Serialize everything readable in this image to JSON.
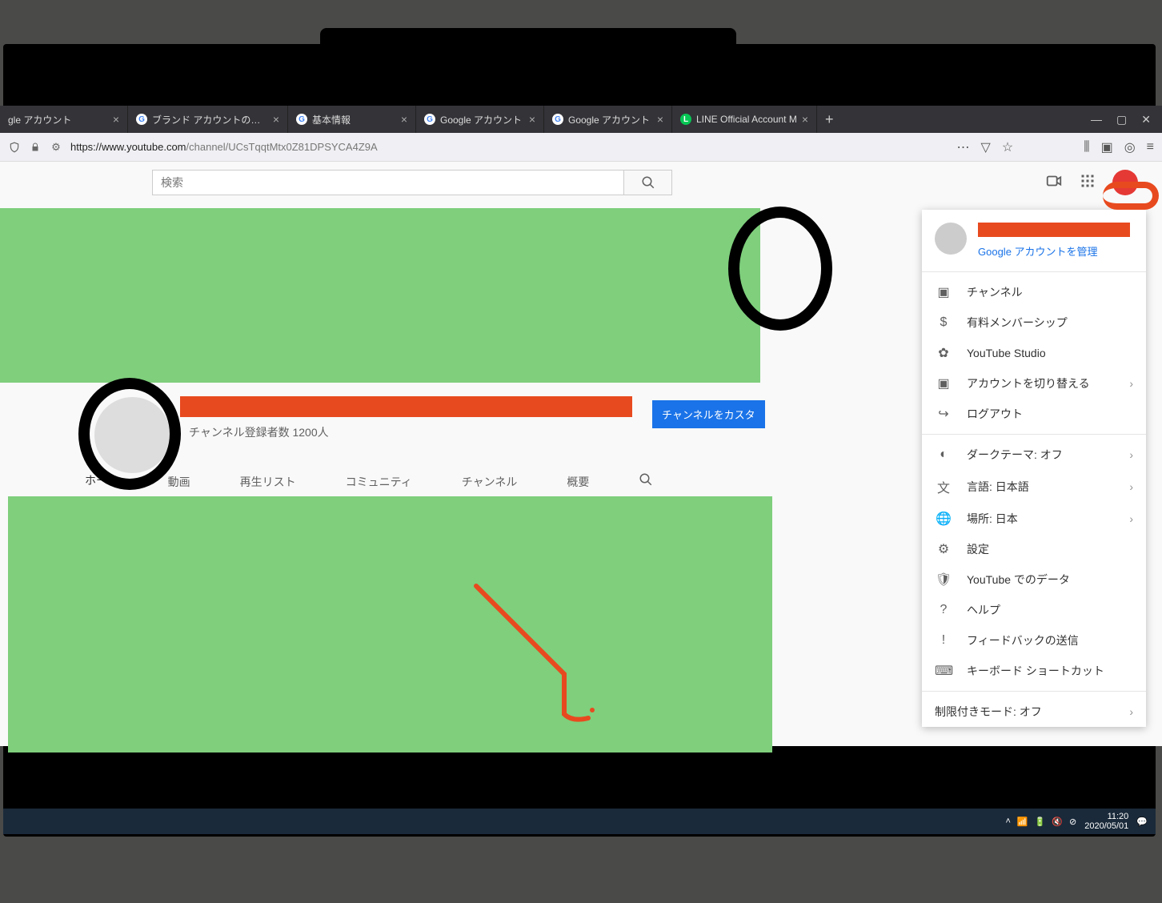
{
  "tabs": [
    {
      "label": "gle アカウント",
      "favicon": "G"
    },
    {
      "label": "ブランド アカウントの詳細",
      "favicon": "G"
    },
    {
      "label": "基本情報",
      "favicon": "G"
    },
    {
      "label": "Google アカウント",
      "favicon": "G"
    },
    {
      "label": "Google アカウント",
      "favicon": "G"
    },
    {
      "label": "LINE Official Account M",
      "favicon": "L"
    }
  ],
  "url": {
    "scheme_host": "https://www.youtube.com",
    "path": "/channel/UCsTqqtMtx0Z81DPSYCA4Z9A"
  },
  "search": {
    "placeholder": "検索"
  },
  "channel": {
    "subscribers": "チャンネル登録者数 1200人",
    "customize": "チャンネルをカスタ",
    "tabs": [
      "ホーム",
      "動画",
      "再生リスト",
      "コミュニティ",
      "チャンネル",
      "概要"
    ]
  },
  "account_menu": {
    "manage": "Google アカウントを管理",
    "section1": [
      {
        "icon": "👤",
        "label": "チャンネル"
      },
      {
        "icon": "💲",
        "label": "有料メンバーシップ"
      },
      {
        "icon": "⚙",
        "label": "YouTube Studio"
      },
      {
        "icon": "🔀",
        "label": "アカウントを切り替える",
        "arrow": true
      },
      {
        "icon": "↪",
        "label": "ログアウト"
      }
    ],
    "section2": [
      {
        "icon": "◐",
        "label": "ダークテーマ: オフ",
        "arrow": true
      },
      {
        "icon": "文",
        "label": "言語: 日本語",
        "arrow": true
      },
      {
        "icon": "🌐",
        "label": "場所: 日本",
        "arrow": true
      },
      {
        "icon": "⚙",
        "label": "設定"
      },
      {
        "icon": "🛡",
        "label": "YouTube でのデータ"
      },
      {
        "icon": "?",
        "label": "ヘルプ"
      },
      {
        "icon": "!",
        "label": "フィードバックの送信"
      },
      {
        "icon": "⌨",
        "label": "キーボード ショートカット"
      }
    ],
    "restricted": "制限付きモード: オフ"
  },
  "taskbar": {
    "time": "11:20",
    "date": "2020/05/01"
  }
}
